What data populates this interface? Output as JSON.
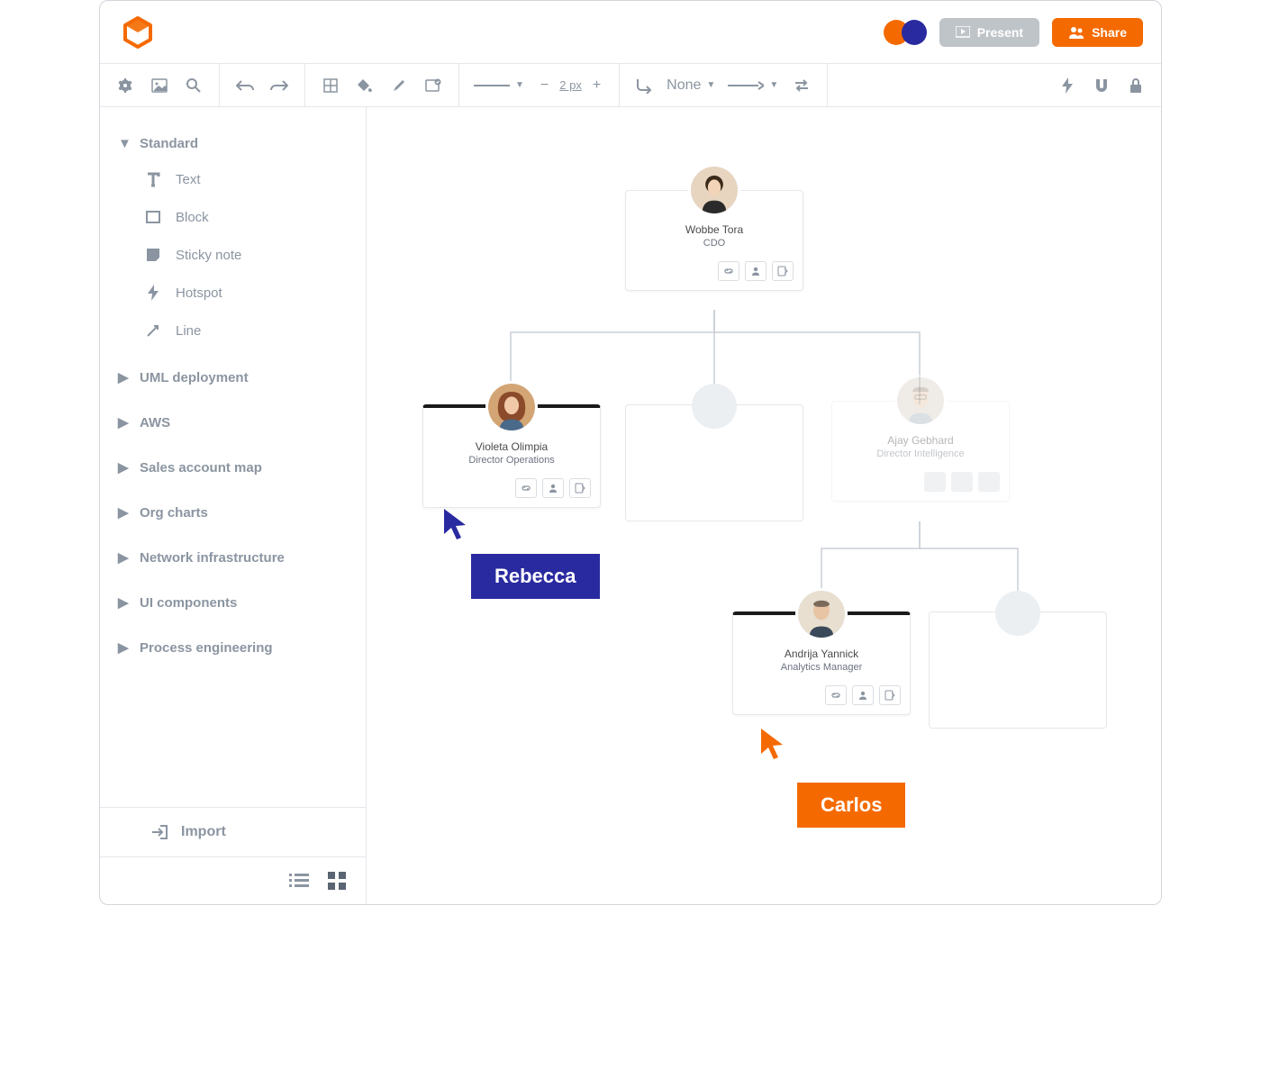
{
  "header": {
    "present_label": "Present",
    "share_label": "Share"
  },
  "toolbar": {
    "stroke_width": "2 px",
    "line_end_none": "None"
  },
  "sidebar": {
    "groups": [
      {
        "label": "Standard",
        "expanded": true,
        "items": [
          {
            "label": "Text"
          },
          {
            "label": "Block"
          },
          {
            "label": "Sticky note"
          },
          {
            "label": "Hotspot"
          },
          {
            "label": "Line"
          }
        ]
      },
      {
        "label": "UML deployment"
      },
      {
        "label": "AWS"
      },
      {
        "label": "Sales account map"
      },
      {
        "label": "Org charts"
      },
      {
        "label": "Network infrastructure"
      },
      {
        "label": "UI components"
      },
      {
        "label": "Process engineering"
      }
    ],
    "import_label": "Import"
  },
  "canvas": {
    "cards": {
      "cdo": {
        "name": "Wobbe Tora",
        "title": "CDO"
      },
      "ops": {
        "name": "Violeta Olimpia",
        "title": "Director Operations"
      },
      "intel": {
        "name": "Ajay Gebhard",
        "title": "Director Intelligence"
      },
      "analytics": {
        "name": "Andrija Yannick",
        "title": "Analytics Manager"
      }
    },
    "cursors": {
      "rebecca": "Rebecca",
      "carlos": "Carlos"
    }
  }
}
